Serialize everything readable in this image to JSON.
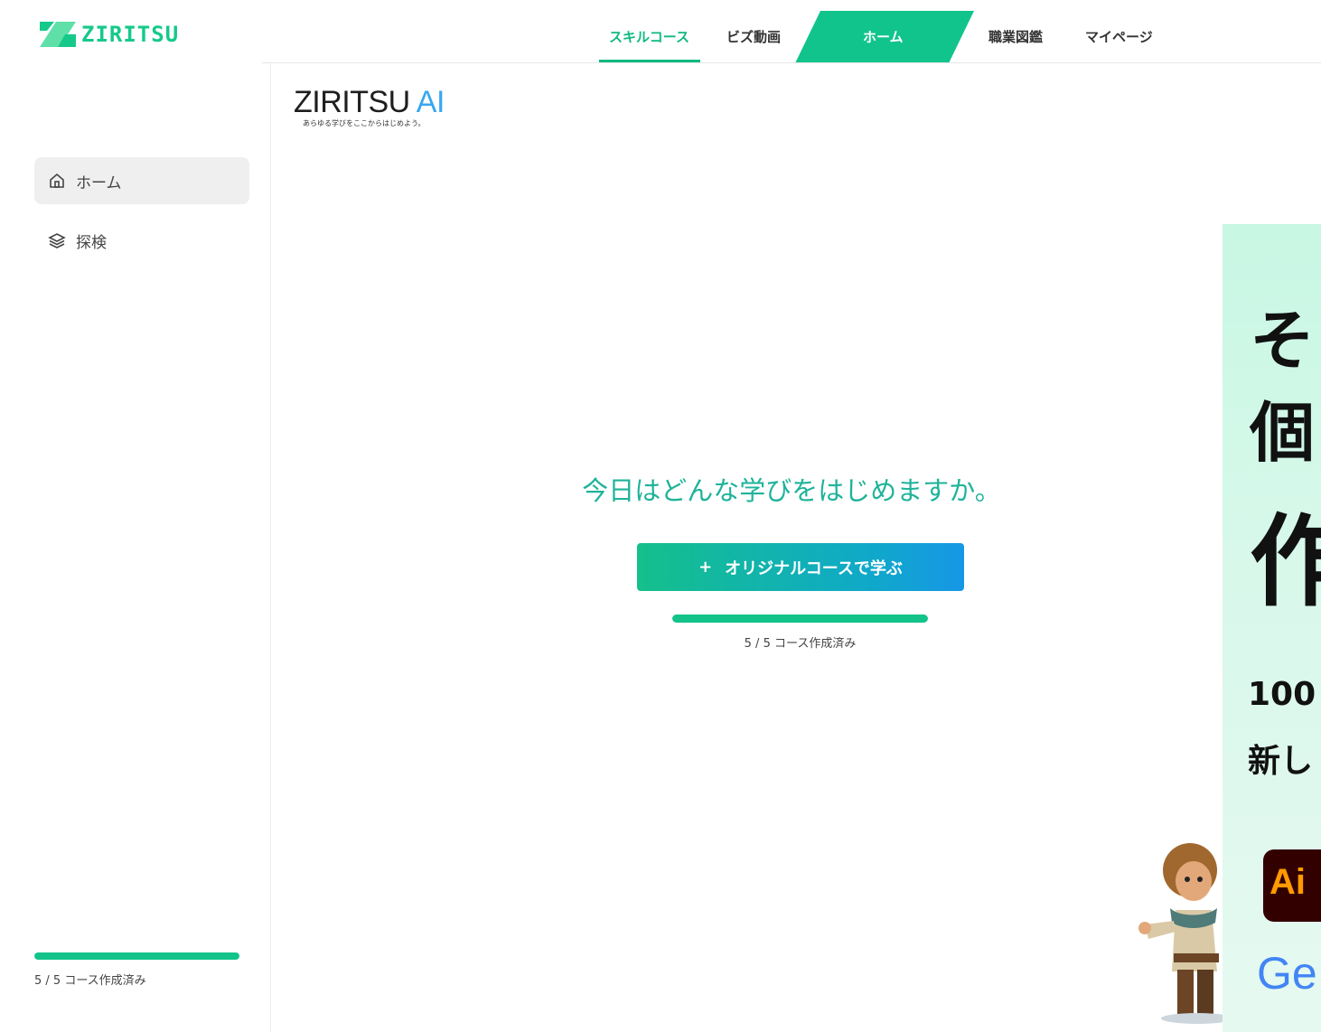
{
  "brand": {
    "logo_text": "ZIRITSU",
    "accent": "#10b981"
  },
  "nav": [
    {
      "label": "スキルコース",
      "active_underline": true
    },
    {
      "label": "ビズ動画"
    },
    {
      "label": "ホーム",
      "current": true
    },
    {
      "label": "職業図鑑"
    },
    {
      "label": "マイページ"
    }
  ],
  "ai_logo": {
    "name": "ZIRITSU",
    "suffix": "AI",
    "tagline": "あらゆる学びをここからはじめよう。"
  },
  "sidebar": {
    "items": [
      {
        "label": "ホーム",
        "icon": "home-icon",
        "active": true
      },
      {
        "label": "探検",
        "icon": "layers-icon"
      }
    ],
    "progress": {
      "value": 5,
      "max": 5,
      "text": "5 / 5 コース作成済み"
    }
  },
  "main": {
    "greeting": "今日はどんな学びをはじめますか。",
    "create_button": {
      "plus": "+",
      "label": "オリジナルコースで学ぶ"
    },
    "progress": {
      "value": 5,
      "max": 5,
      "text": "5 / 5 コース作成済み"
    }
  },
  "promo": {
    "line1": "そ",
    "line2": "個",
    "line3": "作",
    "sub1": "100",
    "sub2": "新し",
    "app_badge": "Ai",
    "brand_partial": "Ge"
  }
}
